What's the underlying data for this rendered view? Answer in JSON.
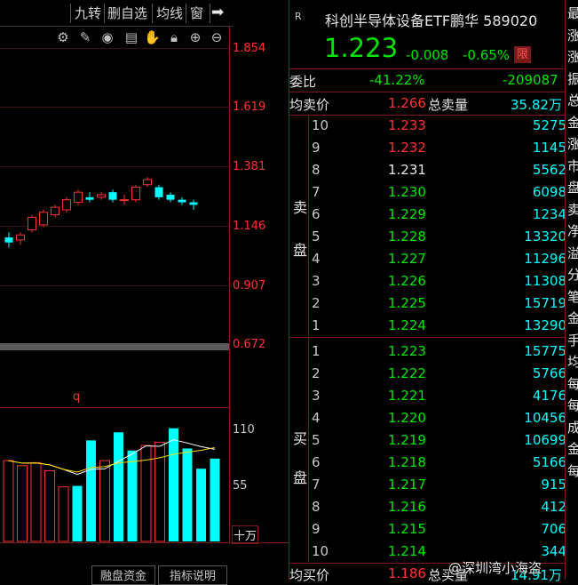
{
  "toolbar": {
    "buttons": [
      "九转",
      "删自选",
      "均线",
      "窗"
    ],
    "arrow": "➡"
  },
  "chart": {
    "price_axis": [
      "1.854",
      "1.619",
      "1.381",
      "1.146",
      "0.907",
      "0.672"
    ],
    "vol_axis": [
      "110",
      "55"
    ],
    "vol_unit": "十万",
    "marker": "q",
    "bottom_tabs": [
      "融盘资金",
      "指标说明"
    ]
  },
  "quote": {
    "r_label": "R",
    "name": "科创半导体设备ETF鹏华 589020",
    "price": "1.223",
    "change": "-0.008",
    "change_pct": "-0.65%",
    "limit_badge": "限",
    "weibi_label": "委比",
    "weibi_pct": "-41.22%",
    "weibi_diff": "-209087",
    "avg_sell_label": "均卖价",
    "avg_sell_price": "1.266",
    "total_sell_label": "总卖量",
    "total_sell_vol": "35.82万",
    "sell_side_label": [
      "卖",
      "盘"
    ],
    "buy_side_label": [
      "买",
      "盘"
    ],
    "avg_buy_label": "均买价",
    "avg_buy_price": "1.186",
    "total_buy_label": "总买量",
    "total_buy_vol": "14.91万"
  },
  "asks": [
    {
      "level": "10",
      "price": "1.233",
      "vol": "5275",
      "color": "#ff3232"
    },
    {
      "level": "9",
      "price": "1.232",
      "vol": "1145",
      "color": "#ff3232"
    },
    {
      "level": "8",
      "price": "1.231",
      "vol": "5562",
      "color": "#e6e6e6"
    },
    {
      "level": "7",
      "price": "1.230",
      "vol": "6098",
      "color": "#00e600"
    },
    {
      "level": "6",
      "price": "1.229",
      "vol": "1234",
      "color": "#00e600"
    },
    {
      "level": "5",
      "price": "1.228",
      "vol": "13320",
      "color": "#00e600"
    },
    {
      "level": "4",
      "price": "1.227",
      "vol": "11296",
      "color": "#00e600"
    },
    {
      "level": "3",
      "price": "1.226",
      "vol": "11308",
      "color": "#00e600"
    },
    {
      "level": "2",
      "price": "1.225",
      "vol": "15719",
      "color": "#00e600"
    },
    {
      "level": "1",
      "price": "1.224",
      "vol": "13290",
      "color": "#00e600"
    }
  ],
  "bids": [
    {
      "level": "1",
      "price": "1.223",
      "vol": "15775",
      "color": "#00e600"
    },
    {
      "level": "2",
      "price": "1.222",
      "vol": "5766",
      "color": "#00e600"
    },
    {
      "level": "3",
      "price": "1.221",
      "vol": "4176",
      "color": "#00e600"
    },
    {
      "level": "4",
      "price": "1.220",
      "vol": "10456",
      "color": "#00e600"
    },
    {
      "level": "5",
      "price": "1.219",
      "vol": "10699",
      "color": "#00e600"
    },
    {
      "level": "6",
      "price": "1.218",
      "vol": "5166",
      "color": "#00e600"
    },
    {
      "level": "7",
      "price": "1.217",
      "vol": "915",
      "color": "#00e600"
    },
    {
      "level": "8",
      "price": "1.216",
      "vol": "412",
      "color": "#00e600"
    },
    {
      "level": "9",
      "price": "1.215",
      "vol": "706",
      "color": "#00e600"
    },
    {
      "level": "10",
      "price": "1.214",
      "vol": "344",
      "color": "#00e600"
    }
  ],
  "side_panel_chars": [
    "最",
    "涨",
    "涨",
    "振",
    "总",
    "金",
    "涨",
    "市",
    "盘",
    "卖",
    "净",
    "溢",
    "分",
    "笔",
    "金",
    "手",
    "均",
    "每",
    "每",
    "成",
    "金",
    "每"
  ],
  "watermark": "@深圳湾小海盗",
  "candles": [
    {
      "o": 1.1,
      "c": 1.08,
      "h": 1.12,
      "l": 1.06
    },
    {
      "o": 1.09,
      "c": 1.11,
      "h": 1.12,
      "l": 1.07
    },
    {
      "o": 1.13,
      "c": 1.18,
      "h": 1.19,
      "l": 1.12
    },
    {
      "o": 1.15,
      "c": 1.2,
      "h": 1.21,
      "l": 1.14
    },
    {
      "o": 1.19,
      "c": 1.22,
      "h": 1.23,
      "l": 1.18
    },
    {
      "o": 1.21,
      "c": 1.25,
      "h": 1.26,
      "l": 1.2
    },
    {
      "o": 1.24,
      "c": 1.28,
      "h": 1.29,
      "l": 1.23
    },
    {
      "o": 1.26,
      "c": 1.25,
      "h": 1.28,
      "l": 1.24
    },
    {
      "o": 1.26,
      "c": 1.27,
      "h": 1.28,
      "l": 1.25
    },
    {
      "o": 1.28,
      "c": 1.25,
      "h": 1.29,
      "l": 1.24
    },
    {
      "o": 1.25,
      "c": 1.25,
      "h": 1.27,
      "l": 1.23
    },
    {
      "o": 1.25,
      "c": 1.3,
      "h": 1.31,
      "l": 1.24
    },
    {
      "o": 1.31,
      "c": 1.33,
      "h": 1.34,
      "l": 1.3
    },
    {
      "o": 1.3,
      "c": 1.26,
      "h": 1.31,
      "l": 1.25
    },
    {
      "o": 1.27,
      "c": 1.25,
      "h": 1.28,
      "l": 1.24
    },
    {
      "o": 1.25,
      "c": 1.24,
      "h": 1.26,
      "l": 1.23
    },
    {
      "o": 1.24,
      "c": 1.23,
      "h": 1.25,
      "l": 1.21
    }
  ],
  "volumes": [
    {
      "v": 80,
      "up": true
    },
    {
      "v": 75,
      "up": true
    },
    {
      "v": 78,
      "up": true
    },
    {
      "v": 70,
      "up": true
    },
    {
      "v": 54,
      "up": true
    },
    {
      "v": 55,
      "up": false
    },
    {
      "v": 100,
      "up": false
    },
    {
      "v": 80,
      "up": true
    },
    {
      "v": 108,
      "up": false
    },
    {
      "v": 90,
      "up": false
    },
    {
      "v": 95,
      "up": true
    },
    {
      "v": 98,
      "up": true
    },
    {
      "v": 112,
      "up": false
    },
    {
      "v": 92,
      "up": false
    },
    {
      "v": 72,
      "up": false
    },
    {
      "v": 82,
      "up": false
    }
  ]
}
